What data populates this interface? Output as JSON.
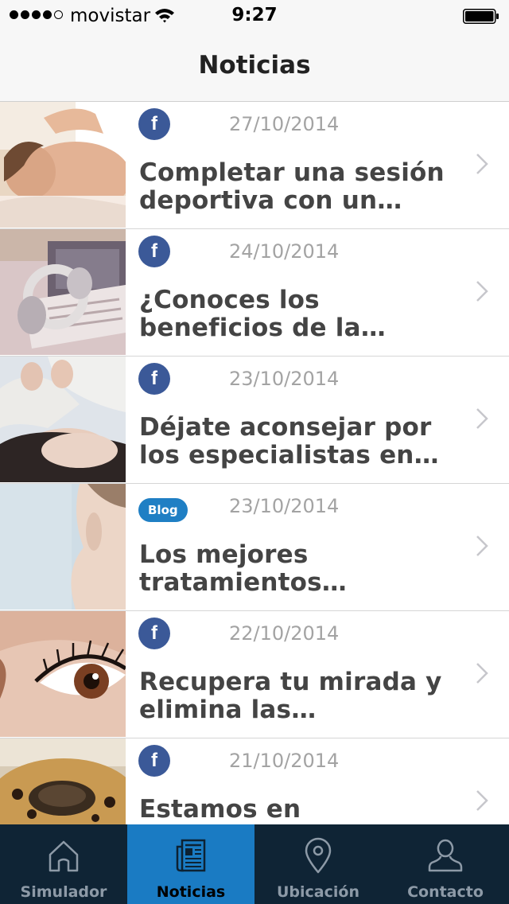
{
  "status_bar": {
    "carrier": "movistar",
    "time": "9:27",
    "signal_bars_filled": 4,
    "signal_bars_total": 5
  },
  "nav": {
    "title": "Noticias"
  },
  "news": [
    {
      "source": "facebook",
      "source_label": "f",
      "date": "27/10/2014",
      "title": "Completar una sesión deportiva con un mas..."
    },
    {
      "source": "facebook",
      "source_label": "f",
      "date": "24/10/2014",
      "title": "¿Conoces los beneficios de la musi..."
    },
    {
      "source": "facebook",
      "source_label": "f",
      "date": "23/10/2014",
      "title": "Déjate aconsejar por los especialistas en a..."
    },
    {
      "source": "blog",
      "source_label": "Blog",
      "date": "23/10/2014",
      "title": "Los mejores tratamientos faciales..."
    },
    {
      "source": "facebook",
      "source_label": "f",
      "date": "22/10/2014",
      "title": "Recupera tu mirada y elimina las antiestétic..."
    },
    {
      "source": "facebook",
      "source_label": "f",
      "date": "21/10/2014",
      "title": "Estamos en temporada"
    }
  ],
  "tabs": [
    {
      "label": "Simulador",
      "icon": "home-icon",
      "active": false
    },
    {
      "label": "Noticias",
      "icon": "newspaper-icon",
      "active": true
    },
    {
      "label": "Ubicación",
      "icon": "location-pin-icon",
      "active": false
    },
    {
      "label": "Contacto",
      "icon": "person-icon",
      "active": false
    }
  ],
  "colors": {
    "facebook": "#3b5998",
    "blog_badge": "#1f7fc4",
    "tab_bar": "#0f2435",
    "tab_active": "#1a7bc3"
  }
}
